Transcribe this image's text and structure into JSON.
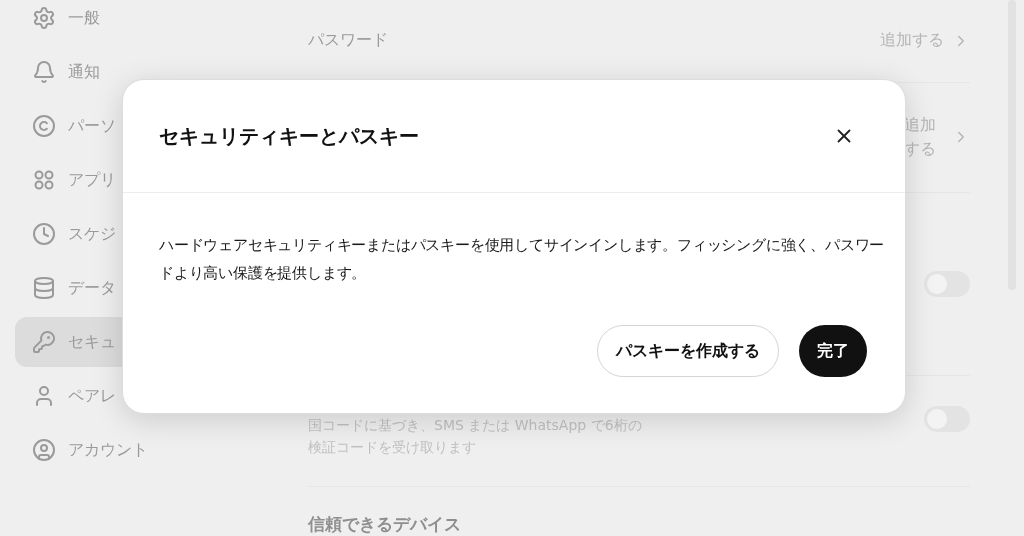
{
  "sidebar": {
    "items": [
      {
        "label": "一般",
        "selected": false
      },
      {
        "label": "通知",
        "selected": false
      },
      {
        "label": "パーソ",
        "selected": false
      },
      {
        "label": "アプリ",
        "selected": false
      },
      {
        "label": "スケジ",
        "selected": false
      },
      {
        "label": "データ",
        "selected": false
      },
      {
        "label": "セキュ",
        "selected": true
      },
      {
        "label": "ペアレ",
        "selected": false
      },
      {
        "label": "アカウント",
        "selected": false
      }
    ]
  },
  "main": {
    "rows": [
      {
        "kind": "link",
        "label": "パスワード",
        "action": "追加する"
      },
      {
        "kind": "link",
        "action": "追加する"
      },
      {
        "kind": "toggle",
        "on": false
      },
      {
        "kind": "toggle",
        "on": false,
        "description": "国コードに基づき、SMS または WhatsApp で6桁の検証コードを受け取ります"
      },
      {
        "kind": "heading",
        "label": "信頼できるデバイス"
      }
    ]
  },
  "dialog": {
    "title": "セキュリティキーとパスキー",
    "body": "ハードウェアセキュリティキーまたはパスキーを使用してサインインします。フィッシングに強く、パスワードより高い保護を提供します。",
    "buttons": [
      {
        "label": "パスキーを作成する",
        "kind": "secondary"
      },
      {
        "label": "完了",
        "kind": "primary"
      }
    ]
  }
}
